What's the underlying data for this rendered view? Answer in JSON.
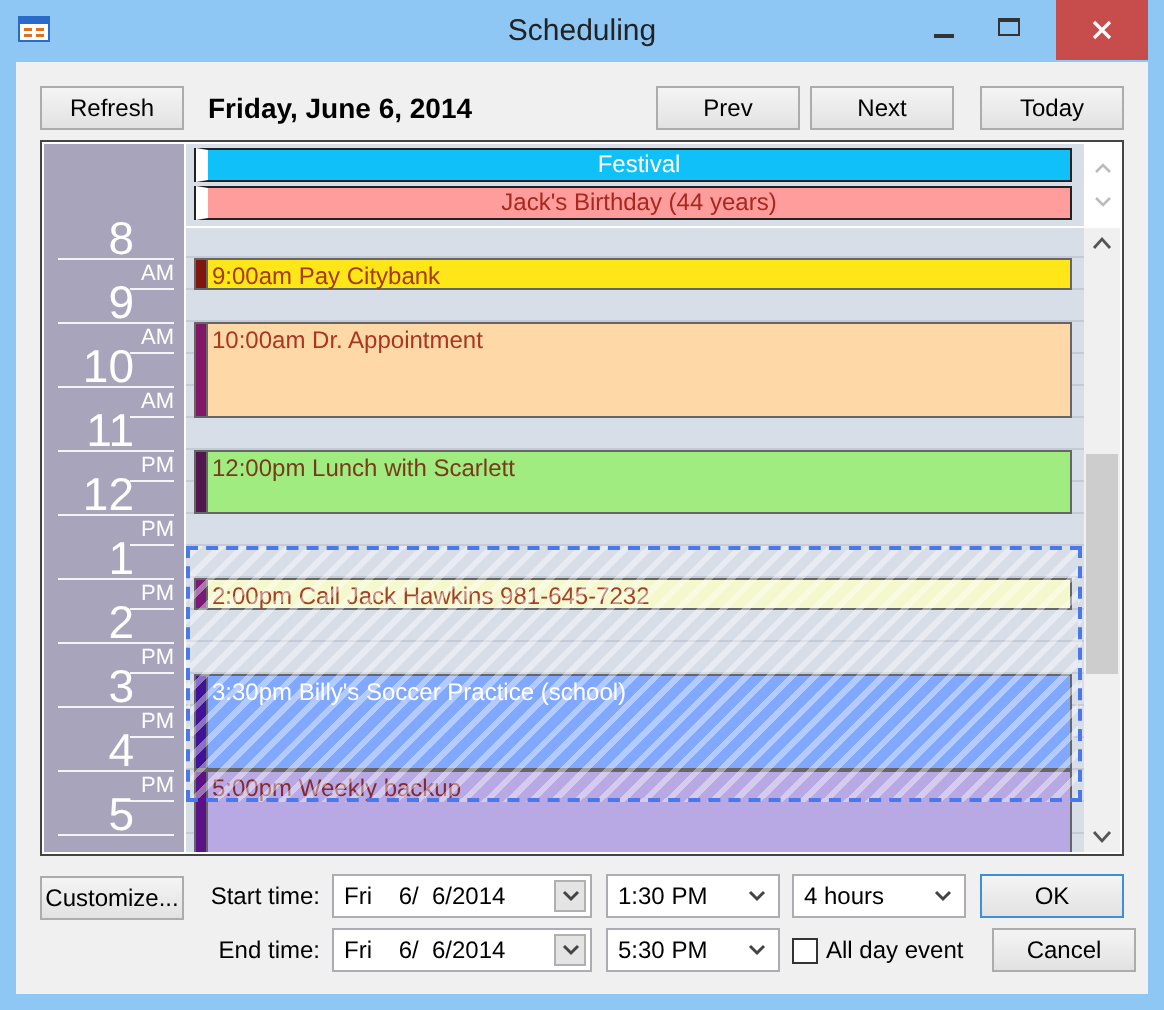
{
  "window": {
    "title": "Scheduling"
  },
  "toolbar": {
    "refresh": "Refresh",
    "date": "Friday, June 6, 2014",
    "prev": "Prev",
    "next": "Next",
    "today": "Today"
  },
  "all_day_events": [
    {
      "text": "Festival",
      "color": "#10c0f8"
    },
    {
      "text": "Jack's Birthday (44 years)",
      "color": "#ff9c9c"
    }
  ],
  "hours": [
    {
      "hour": "8"
    },
    {
      "hour": "9",
      "period": "AM"
    },
    {
      "hour": "10",
      "period": "AM"
    },
    {
      "hour": "11",
      "period": "AM"
    },
    {
      "hour": "12",
      "period": "PM"
    },
    {
      "hour": "1",
      "period": "PM"
    },
    {
      "hour": "2",
      "period": "PM"
    },
    {
      "hour": "3",
      "period": "PM"
    },
    {
      "hour": "4",
      "period": "PM"
    },
    {
      "hour": "5",
      "period": "PM"
    }
  ],
  "events": [
    {
      "text": "9:00am Pay Citybank",
      "kind": "short",
      "color": "#ffe619"
    },
    {
      "text": "10:00am Dr. Appointment",
      "kind": "long",
      "color": "#ffd8a8"
    },
    {
      "text": "12:00pm Lunch with Scarlett",
      "kind": "hour",
      "color": "#a0ec80"
    },
    {
      "text": "2:00pm Call Jack Hawkins 981-645-7232",
      "kind": "short",
      "color": "#f4f8cc"
    },
    {
      "text": "3:30pm Billy's Soccer Practice (school)",
      "kind": "long",
      "color": "#80a8ff"
    },
    {
      "text": "5:00pm Weekly backup",
      "kind": "long",
      "color": "#b8a8e4"
    }
  ],
  "form": {
    "customize": "Customize...",
    "start_label": "Start time:",
    "start_date": "Fri    6/  6/2014",
    "start_time": "1:30 PM",
    "duration": "4 hours",
    "end_label": "End time:",
    "end_date": "Fri    6/  6/2014",
    "end_time": "5:30 PM",
    "all_day": {
      "label": "All day event",
      "checked": false
    },
    "ok": "OK",
    "cancel": "Cancel"
  }
}
